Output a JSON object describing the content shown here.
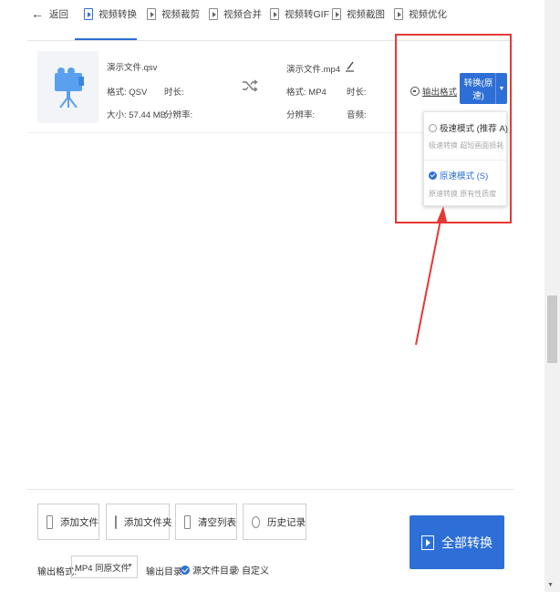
{
  "nav": {
    "back": "返回",
    "tabs": [
      {
        "label": "视频转换",
        "icon": "video-convert-icon"
      },
      {
        "label": "视频裁剪",
        "icon": "video-crop-icon"
      },
      {
        "label": "视频合并",
        "icon": "video-merge-icon"
      },
      {
        "label": "视频转GIF",
        "icon": "gif-icon"
      },
      {
        "label": "视频截图",
        "icon": "screenshot-icon"
      },
      {
        "label": "视频优化",
        "icon": "sliders-icon"
      }
    ]
  },
  "file": {
    "source_name": "演示文件.qsv",
    "source_format": "格式: QSV",
    "source_duration": "时长:",
    "source_size": "大小: 57.44 MB",
    "source_resolution": "分辨率:",
    "target_name": "演示文件.mp4",
    "target_format": "格式: MP4",
    "target_duration": "时长:",
    "target_resolution": "分辨率:",
    "target_audio": "音频:"
  },
  "output_format_link": "输出格式",
  "convert_button": "转换(原速)",
  "mode_dropdown": {
    "options": [
      {
        "title": "极速模式 (推荐 A)",
        "desc": "极速转换 超短画面损耗",
        "selected": false
      },
      {
        "title": "原速模式 (S)",
        "desc": "原速转换 原有性质度",
        "selected": true
      }
    ]
  },
  "toolbar": {
    "add_file": "添加文件",
    "add_folder": "添加文件夹",
    "clear_list": "清空列表",
    "history": "历史记录"
  },
  "convert_all": "全部转换",
  "output": {
    "format_label": "输出格式:",
    "format_value": "MP4 同原文件",
    "dir_label": "输出目录:",
    "dir_options": [
      {
        "label": "源文件目录",
        "selected": true
      },
      {
        "label": "自定义",
        "selected": false
      }
    ]
  },
  "colors": {
    "accent": "#2d6fd6",
    "annotation": "#e53935"
  }
}
